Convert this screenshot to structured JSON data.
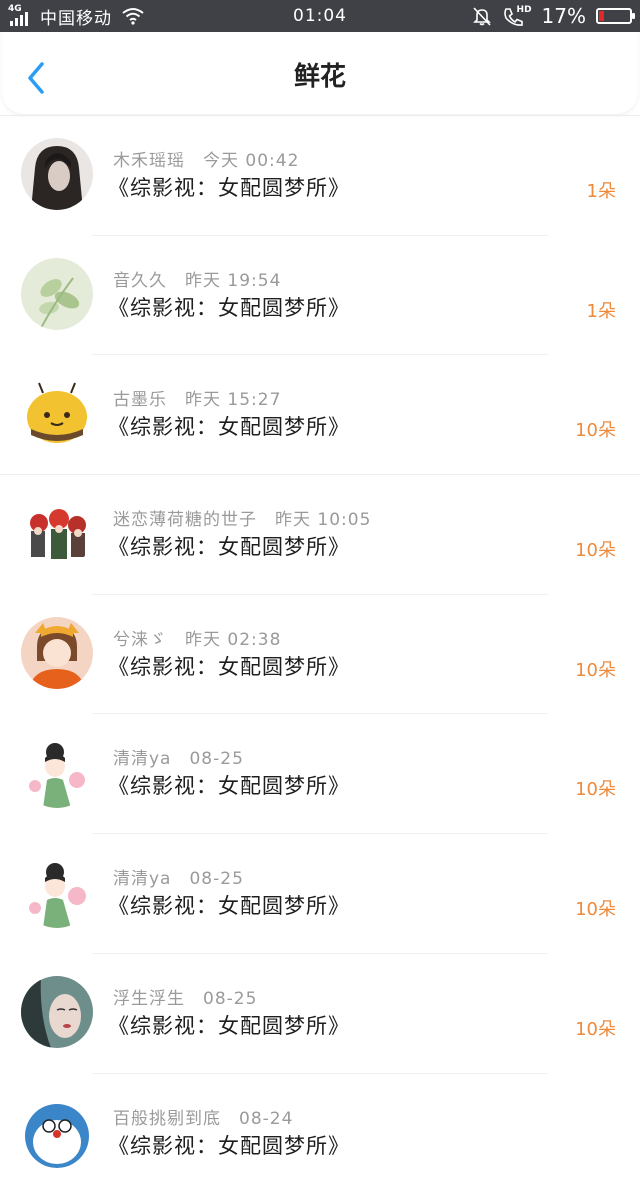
{
  "status_bar": {
    "network": "4G",
    "carrier": "中国移动",
    "time": "01:04",
    "hd": "HD",
    "battery_percent": "17%",
    "battery_level": 0.17,
    "icons": [
      "signal-icon",
      "wifi-icon",
      "mute-bell-icon",
      "call-hd-icon",
      "battery-icon"
    ]
  },
  "header": {
    "title": "鲜花",
    "back_icon": "chevron-left-icon",
    "accent_color": "#2a9df4"
  },
  "colors": {
    "count_color": "#ee8a3a",
    "meta_color": "#9a9a9a"
  },
  "list": {
    "items": [
      {
        "username": "木禾瑶瑶",
        "timestamp": "今天 00:42",
        "book": "《综影视：女配圆梦所》",
        "count": "1朵"
      },
      {
        "username": "音久久",
        "timestamp": "昨天 19:54",
        "book": "《综影视：女配圆梦所》",
        "count": "1朵"
      },
      {
        "username": "古墨乐",
        "timestamp": "昨天 15:27",
        "book": "《综影视：女配圆梦所》",
        "count": "10朵"
      },
      {
        "username": "迷恋薄荷糖的世子",
        "timestamp": "昨天 10:05",
        "book": "《综影视：女配圆梦所》",
        "count": "10朵"
      },
      {
        "username": "兮涞ゞ",
        "timestamp": "昨天 02:38",
        "book": "《综影视：女配圆梦所》",
        "count": "10朵"
      },
      {
        "username": "清清ya",
        "timestamp": "08-25",
        "book": "《综影视：女配圆梦所》",
        "count": "10朵"
      },
      {
        "username": "清清ya",
        "timestamp": "08-25",
        "book": "《综影视：女配圆梦所》",
        "count": "10朵"
      },
      {
        "username": "浮生浮生",
        "timestamp": "08-25",
        "book": "《综影视：女配圆梦所》",
        "count": "10朵"
      },
      {
        "username": "百般挑剔到底",
        "timestamp": "08-24",
        "book": "《综影视：女配圆梦所》",
        "count": ""
      }
    ]
  }
}
